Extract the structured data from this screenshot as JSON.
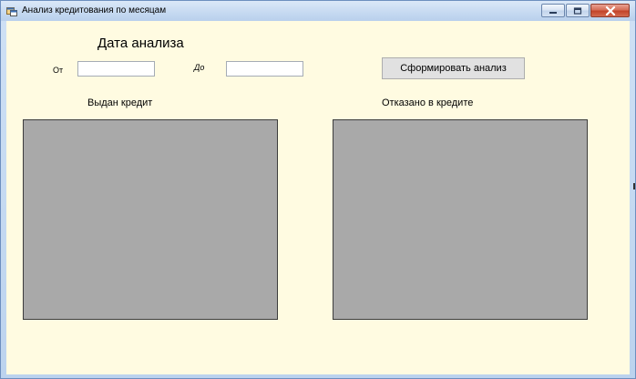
{
  "window": {
    "title": "Анализ кредитования по месяцам"
  },
  "form": {
    "heading": "Дата анализа",
    "from_label": "От",
    "to_label": "До",
    "from_value": "",
    "to_value": "",
    "generate_button": "Сформировать анализ"
  },
  "panels": {
    "issued_label": "Выдан кредит",
    "rejected_label": "Отказано в кредите"
  },
  "colors": {
    "client_background": "#fffbe1",
    "panel_fill": "#a9a9a9",
    "close_button": "#c2442a"
  },
  "icons": {
    "app": "app-window-icon",
    "minimize": "minimize-icon",
    "maximize": "maximize-icon",
    "close": "close-icon"
  }
}
